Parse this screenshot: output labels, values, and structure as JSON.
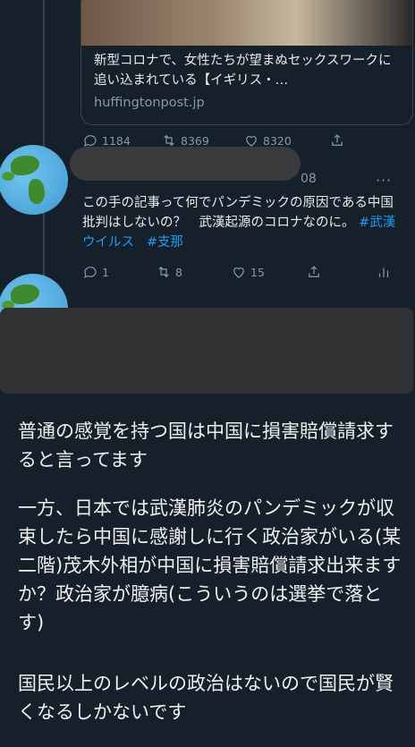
{
  "card": {
    "title": "新型コロナで、女性たちが望まぬセックスワークに追い込まれている【イギリス・…",
    "domain": "huffingtonpost.jp"
  },
  "first_tweet_actions": {
    "replies": "1184",
    "retweets": "8369",
    "likes": "8320"
  },
  "second_tweet": {
    "timestamp": "08",
    "text": "この手の記事って何でパンデミックの原因である中国批判はしないの？　武漢起源のコロナなのに。",
    "hashtags": [
      "#武漢ウイルス",
      "#支那"
    ],
    "replies": "1",
    "retweets": "8",
    "likes": "15"
  },
  "reply": {
    "paragraph1": "普通の感覚を持つ国は中国に損害賠償請求すると言ってます",
    "paragraph2": "一方、日本では武漢肺炎のパンデミックが収束したら中国に感謝しに行く政治家がいる(某二階)茂木外相が中国に損害賠償請求出来ますか？政治家が臆病(こういうのは選挙で落とす)",
    "paragraph3": "国民以上のレベルの政治はないので国民が賢くなるしかないです"
  },
  "icons": [
    "reply-icon",
    "retweet-icon",
    "like-icon",
    "share-icon",
    "analytics-icon",
    "more-icon",
    "globe-avatar"
  ],
  "colors": {
    "background": "#15202b",
    "hashtag": "#1d9bf0",
    "muted": "#8899a6"
  }
}
